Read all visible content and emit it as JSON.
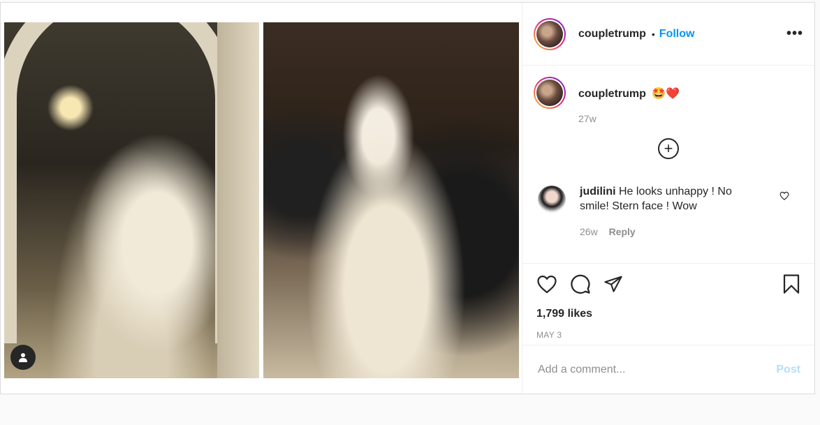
{
  "post": {
    "username": "coupletrump",
    "separator": "•",
    "follow_label": "Follow",
    "more_label": "•••"
  },
  "caption": {
    "username": "coupletrump",
    "emojis": "🤩❤️",
    "time": "27w",
    "load_more_label": "+"
  },
  "comments": [
    {
      "username": "judilini",
      "text": "He looks unhappy ! No smile! Stern face ! Wow",
      "time": "26w",
      "reply_label": "Reply"
    }
  ],
  "actions": {
    "likes": "1,799 likes",
    "date": "MAY 3"
  },
  "add_comment": {
    "placeholder": "Add a comment...",
    "post_label": "Post"
  },
  "colors": {
    "accent": "#0095f6",
    "post_disabled": "#b2dffc",
    "text": "#262626",
    "muted": "#8e8e8e"
  },
  "icons": [
    "heart-icon",
    "comment-icon",
    "share-icon",
    "bookmark-icon",
    "user-tag-icon",
    "plus-circle-icon",
    "more-icon"
  ]
}
